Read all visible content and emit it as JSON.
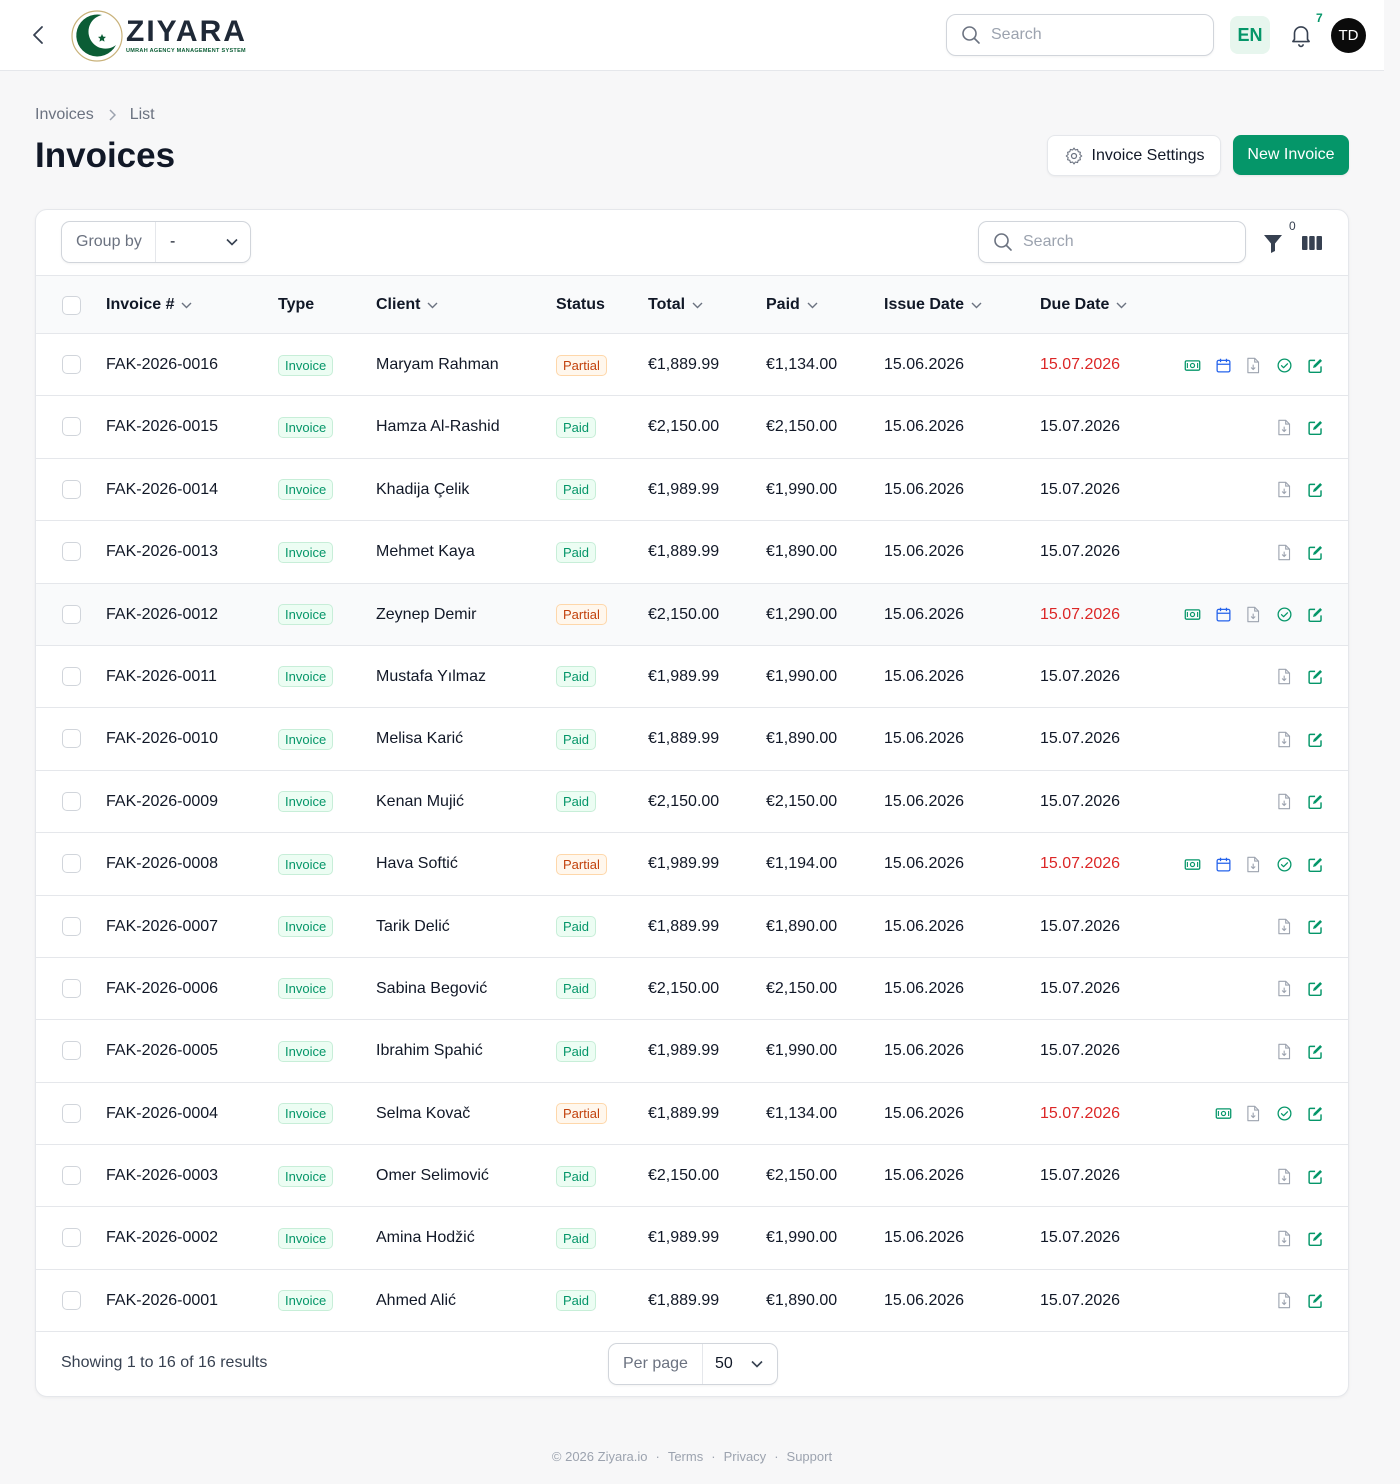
{
  "header": {
    "brand": {
      "name": "ZIYARA",
      "tagline": "UMRAH AGENCY MANAGEMENT SYSTEM"
    },
    "search_placeholder": "Search",
    "language": "EN",
    "notification_count": "7",
    "avatar_initials": "TD"
  },
  "breadcrumb": {
    "items": [
      "Invoices",
      "List"
    ]
  },
  "page": {
    "title": "Invoices",
    "settings_label": "Invoice Settings",
    "new_label": "New Invoice"
  },
  "toolbar": {
    "group_by_label": "Group by",
    "group_by_value": "-",
    "search_placeholder": "Search",
    "filter_count": "0"
  },
  "table": {
    "columns": {
      "invoice": "Invoice #",
      "type": "Type",
      "client": "Client",
      "status": "Status",
      "total": "Total",
      "paid": "Paid",
      "issue_date": "Issue Date",
      "due_date": "Due Date"
    },
    "rows": [
      {
        "invoice": "FAK-2026-0016",
        "type": "Invoice",
        "client": "Maryam Rahman",
        "status": "Partial",
        "total": "€1,889.99",
        "paid": "€1,134.00",
        "issue": "15.06.2026",
        "due": "15.07.2026",
        "actions": [
          "payment",
          "schedule",
          "pdf",
          "approve",
          "edit"
        ]
      },
      {
        "invoice": "FAK-2026-0015",
        "type": "Invoice",
        "client": "Hamza Al-Rashid",
        "status": "Paid",
        "total": "€2,150.00",
        "paid": "€2,150.00",
        "issue": "15.06.2026",
        "due": "15.07.2026",
        "actions": [
          "pdf",
          "edit"
        ]
      },
      {
        "invoice": "FAK-2026-0014",
        "type": "Invoice",
        "client": "Khadija Çelik",
        "status": "Paid",
        "total": "€1,989.99",
        "paid": "€1,990.00",
        "issue": "15.06.2026",
        "due": "15.07.2026",
        "actions": [
          "pdf",
          "edit"
        ]
      },
      {
        "invoice": "FAK-2026-0013",
        "type": "Invoice",
        "client": "Mehmet Kaya",
        "status": "Paid",
        "total": "€1,889.99",
        "paid": "€1,890.00",
        "issue": "15.06.2026",
        "due": "15.07.2026",
        "actions": [
          "pdf",
          "edit"
        ]
      },
      {
        "invoice": "FAK-2026-0012",
        "type": "Invoice",
        "client": "Zeynep Demir",
        "status": "Partial",
        "total": "€2,150.00",
        "paid": "€1,290.00",
        "issue": "15.06.2026",
        "due": "15.07.2026",
        "actions": [
          "payment",
          "schedule",
          "pdf",
          "approve",
          "edit"
        ]
      },
      {
        "invoice": "FAK-2026-0011",
        "type": "Invoice",
        "client": "Mustafa Yılmaz",
        "status": "Paid",
        "total": "€1,989.99",
        "paid": "€1,990.00",
        "issue": "15.06.2026",
        "due": "15.07.2026",
        "actions": [
          "pdf",
          "edit"
        ]
      },
      {
        "invoice": "FAK-2026-0010",
        "type": "Invoice",
        "client": "Melisa Karić",
        "status": "Paid",
        "total": "€1,889.99",
        "paid": "€1,890.00",
        "issue": "15.06.2026",
        "due": "15.07.2026",
        "actions": [
          "pdf",
          "edit"
        ]
      },
      {
        "invoice": "FAK-2026-0009",
        "type": "Invoice",
        "client": "Kenan Mujić",
        "status": "Paid",
        "total": "€2,150.00",
        "paid": "€2,150.00",
        "issue": "15.06.2026",
        "due": "15.07.2026",
        "actions": [
          "pdf",
          "edit"
        ]
      },
      {
        "invoice": "FAK-2026-0008",
        "type": "Invoice",
        "client": "Hava Softić",
        "status": "Partial",
        "total": "€1,989.99",
        "paid": "€1,194.00",
        "issue": "15.06.2026",
        "due": "15.07.2026",
        "actions": [
          "payment",
          "schedule",
          "pdf",
          "approve",
          "edit"
        ]
      },
      {
        "invoice": "FAK-2026-0007",
        "type": "Invoice",
        "client": "Tarik Delić",
        "status": "Paid",
        "total": "€1,889.99",
        "paid": "€1,890.00",
        "issue": "15.06.2026",
        "due": "15.07.2026",
        "actions": [
          "pdf",
          "edit"
        ]
      },
      {
        "invoice": "FAK-2026-0006",
        "type": "Invoice",
        "client": "Sabina Begović",
        "status": "Paid",
        "total": "€2,150.00",
        "paid": "€2,150.00",
        "issue": "15.06.2026",
        "due": "15.07.2026",
        "actions": [
          "pdf",
          "edit"
        ]
      },
      {
        "invoice": "FAK-2026-0005",
        "type": "Invoice",
        "client": "Ibrahim Spahić",
        "status": "Paid",
        "total": "€1,989.99",
        "paid": "€1,990.00",
        "issue": "15.06.2026",
        "due": "15.07.2026",
        "actions": [
          "pdf",
          "edit"
        ]
      },
      {
        "invoice": "FAK-2026-0004",
        "type": "Invoice",
        "client": "Selma Kovač",
        "status": "Partial",
        "total": "€1,889.99",
        "paid": "€1,134.00",
        "issue": "15.06.2026",
        "due": "15.07.2026",
        "actions": [
          "payment",
          "pdf",
          "approve",
          "edit"
        ]
      },
      {
        "invoice": "FAK-2026-0003",
        "type": "Invoice",
        "client": "Omer Selimović",
        "status": "Paid",
        "total": "€2,150.00",
        "paid": "€2,150.00",
        "issue": "15.06.2026",
        "due": "15.07.2026",
        "actions": [
          "pdf",
          "edit"
        ]
      },
      {
        "invoice": "FAK-2026-0002",
        "type": "Invoice",
        "client": "Amina Hodžić",
        "status": "Paid",
        "total": "€1,989.99",
        "paid": "€1,990.00",
        "issue": "15.06.2026",
        "due": "15.07.2026",
        "actions": [
          "pdf",
          "edit"
        ]
      },
      {
        "invoice": "FAK-2026-0001",
        "type": "Invoice",
        "client": "Ahmed Alić",
        "status": "Paid",
        "total": "€1,889.99",
        "paid": "€1,890.00",
        "issue": "15.06.2026",
        "due": "15.07.2026",
        "actions": [
          "pdf",
          "edit"
        ]
      }
    ]
  },
  "pagination": {
    "summary": "Showing 1 to 16 of 16 results",
    "per_page_label": "Per page",
    "per_page_value": "50"
  },
  "footer": {
    "links": [
      "© 2026 Ziyara.io",
      "Terms",
      "Privacy",
      "Support"
    ]
  },
  "colors": {
    "accent": "#059669",
    "overdue": "#dc2626",
    "partial": "#c2410c",
    "schedule_icon": "#2563eb"
  }
}
